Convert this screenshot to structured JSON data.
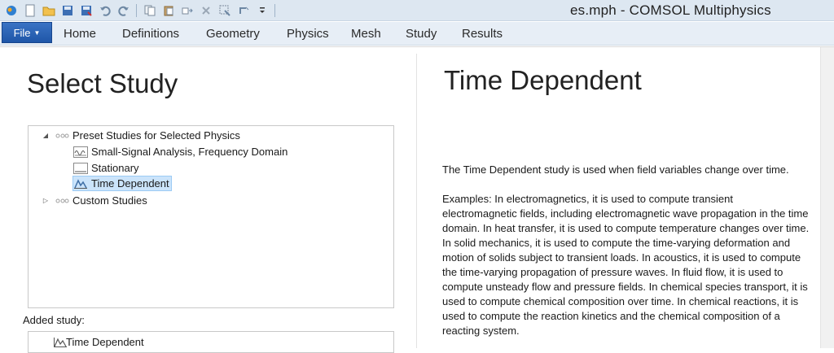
{
  "window": {
    "title": "es.mph - COMSOL Multiphysics"
  },
  "quick_access": [
    {
      "icon": "comsol-logo-icon"
    },
    {
      "icon": "new-file-icon"
    },
    {
      "icon": "open-folder-icon"
    },
    {
      "icon": "save-icon"
    },
    {
      "icon": "save-as-icon"
    },
    {
      "icon": "undo-icon"
    },
    {
      "icon": "redo-icon"
    },
    {
      "icon": "copy-icon"
    },
    {
      "icon": "paste-icon"
    },
    {
      "icon": "duplicate-icon"
    },
    {
      "icon": "delete-icon"
    },
    {
      "icon": "select-icon"
    },
    {
      "icon": "windows-icon"
    },
    {
      "icon": "customize-dropdown-icon"
    }
  ],
  "ribbon": {
    "file_label": "File",
    "tabs": [
      "Home",
      "Definitions",
      "Geometry",
      "Physics",
      "Mesh",
      "Study",
      "Results"
    ]
  },
  "left": {
    "heading": "Select Study",
    "tree": {
      "group": "Preset Studies for Selected Physics",
      "items": [
        "Small-Signal Analysis, Frequency Domain",
        "Stationary",
        "Time Dependent"
      ],
      "selected": "Time Dependent",
      "custom": "Custom Studies"
    },
    "added_label": "Added study:",
    "added_value": "Time Dependent"
  },
  "right": {
    "heading": "Time Dependent",
    "paragraph1": "The Time Dependent study is used when field variables change over time.",
    "paragraph2": "Examples: In electromagnetics, it is used to compute transient electromagnetic fields, including electromagnetic wave propagation in the time domain. In heat transfer, it is used to compute temperature changes over time. In solid mechanics, it is used to compute the time-varying deformation and motion of solids subject to transient loads. In acoustics, it is used to compute the time-varying propagation of pressure waves. In fluid flow, it is used to compute unsteady flow and pressure fields. In chemical species transport, it is used to compute chemical composition over time. In chemical reactions, it is used to compute the reaction kinetics and the chemical composition of a reacting system."
  },
  "colors": {
    "file_tab": "#2a63b6",
    "selection": "#cbe4fb",
    "titlebar": "#dde7f1"
  }
}
